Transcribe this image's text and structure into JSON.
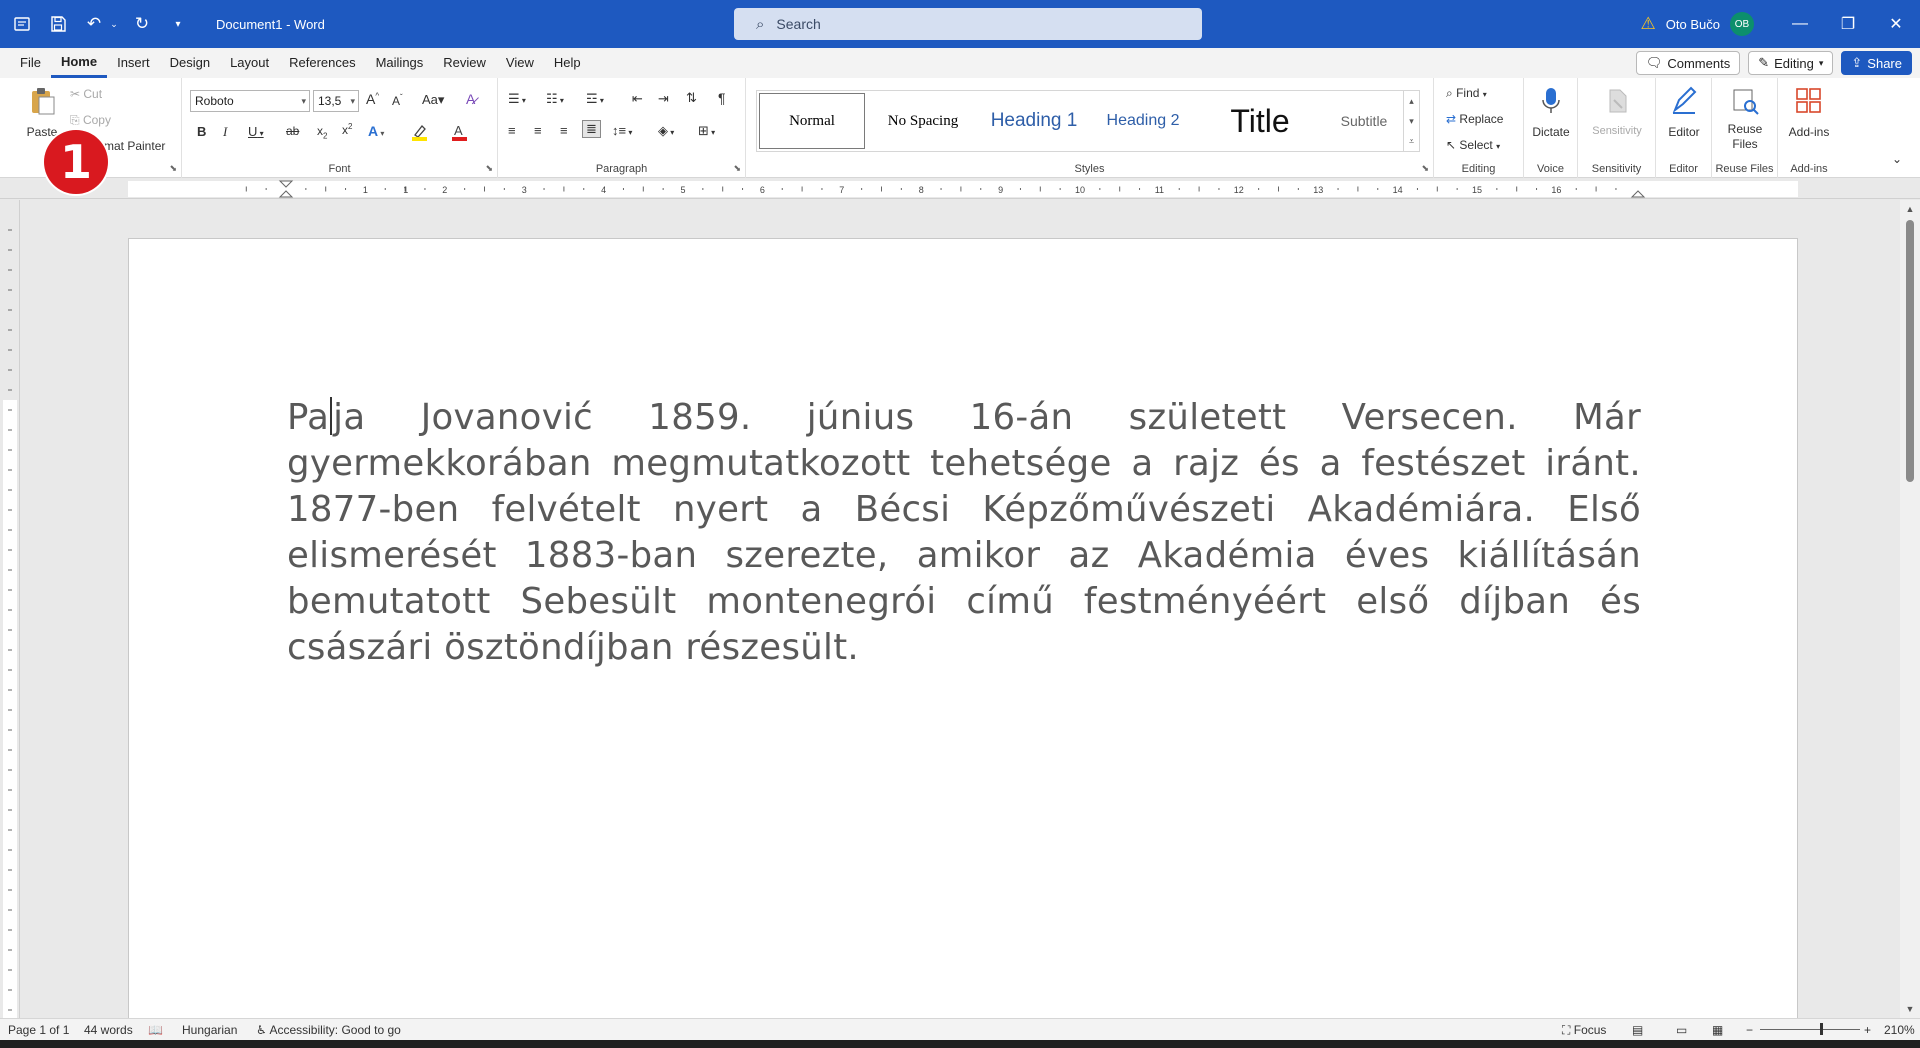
{
  "titlebar": {
    "doc_title": "Document1  -  Word",
    "search_placeholder": "Search",
    "user_name": "Oto Bučo",
    "user_initials": "OB"
  },
  "menu": {
    "tabs": [
      "File",
      "Home",
      "Insert",
      "Design",
      "Layout",
      "References",
      "Mailings",
      "Review",
      "View",
      "Help"
    ],
    "active": "Home",
    "comments": "Comments",
    "editing": "Editing",
    "share": "Share"
  },
  "ribbon": {
    "clipboard": {
      "paste": "Paste",
      "cut": "Cut",
      "copy": "Copy",
      "format_painter": "mat Painter",
      "label": "d"
    },
    "font": {
      "name": "Roboto",
      "size": "13,5",
      "label": "Font"
    },
    "paragraph": {
      "label": "Paragraph"
    },
    "styles": {
      "items": [
        "Normal",
        "No Spacing",
        "Heading 1",
        "Heading 2",
        "Title",
        "Subtitle"
      ],
      "label": "Styles"
    },
    "editing": {
      "find": "Find",
      "replace": "Replace",
      "select": "Select",
      "label": "Editing"
    },
    "voice": {
      "dictate": "Dictate",
      "label": "Voice"
    },
    "sensitivity": {
      "button": "Sensitivity",
      "label": "Sensitivity"
    },
    "editor": {
      "button": "Editor",
      "label": "Editor"
    },
    "reuse": {
      "button_line1": "Reuse",
      "button_line2": "Files",
      "label": "Reuse Files"
    },
    "addins": {
      "button": "Add-ins",
      "label": "Add-ins"
    }
  },
  "annotation_badge": "1",
  "document": {
    "text_before_caret": "Pa",
    "text_after_caret": "ja Jovanović 1859. június 16-án született Versecen. Már gyermekkorában megmutatkozott tehetsége a rajz és a festészet iránt. 1877-ben felvételt nyert a Bécsi Képzőművészeti Akadémiára. Első elismerését 1883-ban szerezte, amikor az Akadémia éves kiállításán bemutatott Sebesült montenegrói című festményéért első díjban és császári ösztöndíjban részesült."
  },
  "ruler_numbers": [
    "1",
    "1",
    "2",
    "3",
    "4",
    "5",
    "6",
    "7",
    "8",
    "9",
    "10",
    "11",
    "12",
    "13",
    "14",
    "15",
    "16"
  ],
  "statusbar": {
    "page": "Page 1 of 1",
    "words": "44 words",
    "language": "Hungarian",
    "accessibility": "Accessibility: Good to go",
    "focus": "Focus",
    "zoom": "210%"
  },
  "colors": {
    "accent": "#1e59c0",
    "badge": "#d9191f",
    "body_text": "#595959"
  }
}
